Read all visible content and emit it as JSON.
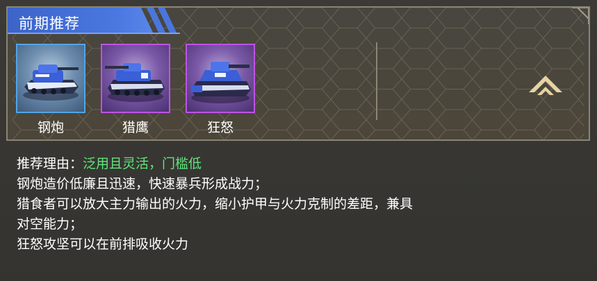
{
  "section": {
    "title": "前期推荐"
  },
  "units": [
    {
      "name": "钢炮",
      "rarity": "blue"
    },
    {
      "name": "猎鹰",
      "rarity": "purple"
    },
    {
      "name": "狂怒",
      "rarity": "purple"
    }
  ],
  "collapse_icon": "chevron-up-icon",
  "recommendation": {
    "label": "推荐理由：",
    "value": "泛用且灵活，门槛低",
    "lines": [
      "钢炮造价低廉且迅速，快速暴兵形成战力；",
      "猎食者可以放大主力输出的火力，缩小护甲与火力克制的差距，兼具",
      "对空能力；",
      "狂怒攻坚可以在前排吸收火力"
    ]
  },
  "colors": {
    "title_tab": "#3f6fd8",
    "reason_highlight": "#5fe67b",
    "rarity_blue": "#4fa6e8",
    "rarity_purple": "#c052e6",
    "chevron": "#e6d3a2"
  }
}
